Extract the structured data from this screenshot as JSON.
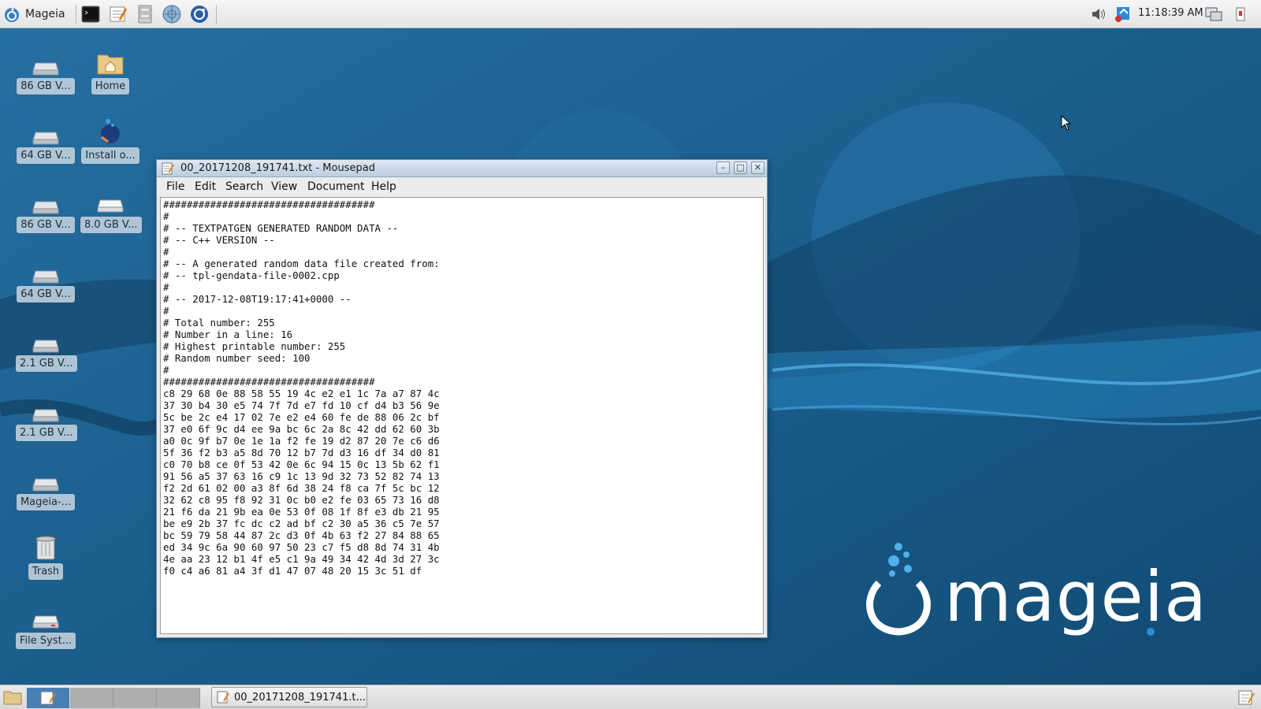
{
  "top_panel": {
    "menu_label": "Mageia",
    "clock": "11:18:39 AM",
    "launchers": [
      "terminal-icon",
      "text-editor-icon",
      "file-manager-icon",
      "web-browser-icon",
      "settings-icon"
    ]
  },
  "desktop": {
    "icons": [
      {
        "label": "86 GB V...",
        "icon": "drive-icon"
      },
      {
        "label": "Home",
        "icon": "home-folder-icon"
      },
      {
        "label": "64 GB V...",
        "icon": "drive-icon"
      },
      {
        "label": "Install o...",
        "icon": "install-icon"
      },
      {
        "label": "86 GB V...",
        "icon": "drive-icon"
      },
      {
        "label": "8.0 GB V...",
        "icon": "drive-icon"
      },
      {
        "label": "64 GB V...",
        "icon": "drive-icon"
      },
      {
        "label": "2.1 GB V...",
        "icon": "drive-icon"
      },
      {
        "label": "2.1 GB V...",
        "icon": "drive-icon"
      },
      {
        "label": "Mageia-...",
        "icon": "drive-icon"
      },
      {
        "label": "Trash",
        "icon": "trash-icon"
      },
      {
        "label": "File Syst...",
        "icon": "drive-icon"
      }
    ],
    "logo_text": "mageia"
  },
  "window": {
    "title": "00_20171208_191741.txt - Mousepad",
    "menus": [
      "File",
      "Edit",
      "Search",
      "View",
      "Document",
      "Help"
    ],
    "content": "####################################\n#\n# -- TEXTPATGEN GENERATED RANDOM DATA --\n# -- C++ VERSION --\n#\n# -- A generated random data file created from:\n# -- tpl-gendata-file-0002.cpp\n#\n# -- 2017-12-08T19:17:41+0000 --\n#\n# Total number: 255\n# Number in a line: 16\n# Highest printable number: 255\n# Random number seed: 100\n#\n####################################\nc8 29 68 0e 88 58 55 19 4c e2 e1 1c 7a a7 87 4c\n37 30 b4 30 e5 74 7f 7d e7 fd 10 cf d4 b3 56 9e\n5c be 2c e4 17 02 7e e2 e4 60 fe de 88 06 2c bf\n37 e0 6f 9c d4 ee 9a bc 6c 2a 8c 42 dd 62 60 3b\na0 0c 9f b7 0e 1e 1a f2 fe 19 d2 87 20 7e c6 d6\n5f 36 f2 b3 a5 8d 70 12 b7 7d d3 16 df 34 d0 81\nc0 70 b8 ce 0f 53 42 0e 6c 94 15 0c 13 5b 62 f1\n91 56 a5 37 63 16 c9 1c 13 9d 32 73 52 82 74 13\nf2 2d 61 02 00 a3 8f 6d 38 24 f8 ca 7f 5c bc 12\n32 62 c8 95 f8 92 31 0c b0 e2 fe 03 65 73 16 d8\n21 f6 da 21 9b ea 0e 53 0f 08 1f 8f e3 db 21 95\nbe e9 2b 37 fc dc c2 ad bf c2 30 a5 36 c5 7e 57\nbc 59 79 58 44 87 2c d3 0f 4b 63 f2 27 84 88 65\ned 34 9c 6a 90 60 97 50 23 c7 f5 d8 8d 74 31 4b\n4e aa 23 12 b1 4f e5 c1 9a 49 34 42 4d 3d 27 3c\nf0 c4 a6 81 a4 3f d1 47 07 48 20 15 3c 51 df"
  },
  "bottom_panel": {
    "task_label": "00_20171208_191741.t..."
  },
  "colors": {
    "desktop_bg": "#1b5f8d",
    "accent": "#2a8fd6"
  }
}
